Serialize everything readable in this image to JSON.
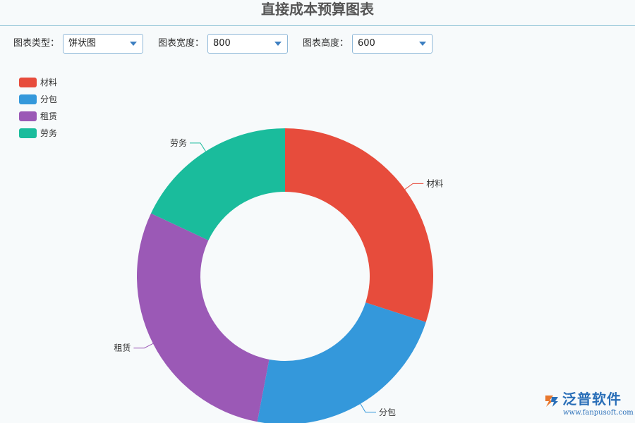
{
  "chart_data": {
    "type": "pie",
    "donut": true,
    "title": "直接成本预算图表",
    "categories": [
      "材料",
      "分包",
      "租赁",
      "劳务"
    ],
    "values": [
      30,
      23,
      29,
      18
    ],
    "colors": [
      "#e74c3c",
      "#3498db",
      "#9b59b6",
      "#1abc9c"
    ],
    "legend_position": "top-left"
  },
  "toolbar": {
    "chart_type_label": "图表类型：",
    "chart_type_value": "饼状图",
    "width_label": "图表宽度：",
    "width_value": "800",
    "height_label": "图表高度：",
    "height_value": "600"
  },
  "logo": {
    "name": "泛普软件",
    "url": "www.fanpusoft.com"
  }
}
